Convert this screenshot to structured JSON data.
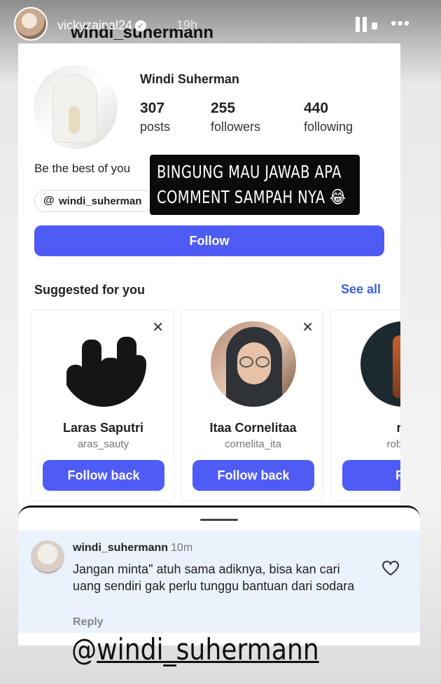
{
  "story": {
    "username": "vickyzainal24",
    "time": "19h"
  },
  "profile": {
    "handle": "windi_suhermann",
    "display_name": "Windi Suherman",
    "stats": [
      {
        "value": "307",
        "label": "posts"
      },
      {
        "value": "255",
        "label": "followers"
      },
      {
        "value": "440",
        "label": "following"
      }
    ],
    "bio": "Be the best of you",
    "threads_handle": "windi_suherman",
    "follow_label": "Follow"
  },
  "caption": {
    "line1": "BINGUNG MAU JAWAB APA",
    "line2": "COMMENT SAMPAH NYA 😂"
  },
  "suggested": {
    "title": "Suggested for you",
    "see_all": "See all",
    "cards": [
      {
        "name": "Laras Saputri",
        "username": "aras_sauty",
        "button": "Follow back"
      },
      {
        "name": "Itaa Cornelitaa",
        "username": "cornelita_ita",
        "button": "Follow back"
      },
      {
        "name": "ro",
        "username": "robnes",
        "button": "Fo"
      }
    ]
  },
  "comment": {
    "username": "windi_suhermann",
    "time": "10m",
    "text": "Jangan minta\" atuh sama adiknya, bisa kan cari uang sendiri gak perlu tunggu bantuan dari sodara",
    "reply_label": "Reply"
  },
  "mention": {
    "text": "windi_suhermann"
  },
  "icons": [
    "pause-icon",
    "more-icon",
    "verified-icon",
    "threads-icon",
    "close-icon",
    "heart-icon"
  ],
  "colors": {
    "accent": "#4e5cf5",
    "link": "#3b63e0",
    "caption_bg": "#0b0b0b",
    "comment_bg": "#eaf2fb"
  }
}
